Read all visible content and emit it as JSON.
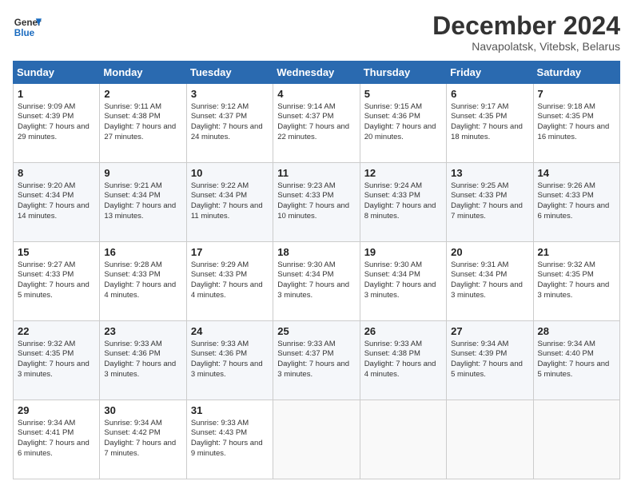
{
  "header": {
    "logo_line1": "General",
    "logo_line2": "Blue",
    "month_title": "December 2024",
    "subtitle": "Navapolatsk, Vitebsk, Belarus"
  },
  "days_of_week": [
    "Sunday",
    "Monday",
    "Tuesday",
    "Wednesday",
    "Thursday",
    "Friday",
    "Saturday"
  ],
  "weeks": [
    [
      {
        "day": "1",
        "sunrise": "Sunrise: 9:09 AM",
        "sunset": "Sunset: 4:39 PM",
        "daylight": "Daylight: 7 hours and 29 minutes."
      },
      {
        "day": "2",
        "sunrise": "Sunrise: 9:11 AM",
        "sunset": "Sunset: 4:38 PM",
        "daylight": "Daylight: 7 hours and 27 minutes."
      },
      {
        "day": "3",
        "sunrise": "Sunrise: 9:12 AM",
        "sunset": "Sunset: 4:37 PM",
        "daylight": "Daylight: 7 hours and 24 minutes."
      },
      {
        "day": "4",
        "sunrise": "Sunrise: 9:14 AM",
        "sunset": "Sunset: 4:37 PM",
        "daylight": "Daylight: 7 hours and 22 minutes."
      },
      {
        "day": "5",
        "sunrise": "Sunrise: 9:15 AM",
        "sunset": "Sunset: 4:36 PM",
        "daylight": "Daylight: 7 hours and 20 minutes."
      },
      {
        "day": "6",
        "sunrise": "Sunrise: 9:17 AM",
        "sunset": "Sunset: 4:35 PM",
        "daylight": "Daylight: 7 hours and 18 minutes."
      },
      {
        "day": "7",
        "sunrise": "Sunrise: 9:18 AM",
        "sunset": "Sunset: 4:35 PM",
        "daylight": "Daylight: 7 hours and 16 minutes."
      }
    ],
    [
      {
        "day": "8",
        "sunrise": "Sunrise: 9:20 AM",
        "sunset": "Sunset: 4:34 PM",
        "daylight": "Daylight: 7 hours and 14 minutes."
      },
      {
        "day": "9",
        "sunrise": "Sunrise: 9:21 AM",
        "sunset": "Sunset: 4:34 PM",
        "daylight": "Daylight: 7 hours and 13 minutes."
      },
      {
        "day": "10",
        "sunrise": "Sunrise: 9:22 AM",
        "sunset": "Sunset: 4:34 PM",
        "daylight": "Daylight: 7 hours and 11 minutes."
      },
      {
        "day": "11",
        "sunrise": "Sunrise: 9:23 AM",
        "sunset": "Sunset: 4:33 PM",
        "daylight": "Daylight: 7 hours and 10 minutes."
      },
      {
        "day": "12",
        "sunrise": "Sunrise: 9:24 AM",
        "sunset": "Sunset: 4:33 PM",
        "daylight": "Daylight: 7 hours and 8 minutes."
      },
      {
        "day": "13",
        "sunrise": "Sunrise: 9:25 AM",
        "sunset": "Sunset: 4:33 PM",
        "daylight": "Daylight: 7 hours and 7 minutes."
      },
      {
        "day": "14",
        "sunrise": "Sunrise: 9:26 AM",
        "sunset": "Sunset: 4:33 PM",
        "daylight": "Daylight: 7 hours and 6 minutes."
      }
    ],
    [
      {
        "day": "15",
        "sunrise": "Sunrise: 9:27 AM",
        "sunset": "Sunset: 4:33 PM",
        "daylight": "Daylight: 7 hours and 5 minutes."
      },
      {
        "day": "16",
        "sunrise": "Sunrise: 9:28 AM",
        "sunset": "Sunset: 4:33 PM",
        "daylight": "Daylight: 7 hours and 4 minutes."
      },
      {
        "day": "17",
        "sunrise": "Sunrise: 9:29 AM",
        "sunset": "Sunset: 4:33 PM",
        "daylight": "Daylight: 7 hours and 4 minutes."
      },
      {
        "day": "18",
        "sunrise": "Sunrise: 9:30 AM",
        "sunset": "Sunset: 4:34 PM",
        "daylight": "Daylight: 7 hours and 3 minutes."
      },
      {
        "day": "19",
        "sunrise": "Sunrise: 9:30 AM",
        "sunset": "Sunset: 4:34 PM",
        "daylight": "Daylight: 7 hours and 3 minutes."
      },
      {
        "day": "20",
        "sunrise": "Sunrise: 9:31 AM",
        "sunset": "Sunset: 4:34 PM",
        "daylight": "Daylight: 7 hours and 3 minutes."
      },
      {
        "day": "21",
        "sunrise": "Sunrise: 9:32 AM",
        "sunset": "Sunset: 4:35 PM",
        "daylight": "Daylight: 7 hours and 3 minutes."
      }
    ],
    [
      {
        "day": "22",
        "sunrise": "Sunrise: 9:32 AM",
        "sunset": "Sunset: 4:35 PM",
        "daylight": "Daylight: 7 hours and 3 minutes."
      },
      {
        "day": "23",
        "sunrise": "Sunrise: 9:33 AM",
        "sunset": "Sunset: 4:36 PM",
        "daylight": "Daylight: 7 hours and 3 minutes."
      },
      {
        "day": "24",
        "sunrise": "Sunrise: 9:33 AM",
        "sunset": "Sunset: 4:36 PM",
        "daylight": "Daylight: 7 hours and 3 minutes."
      },
      {
        "day": "25",
        "sunrise": "Sunrise: 9:33 AM",
        "sunset": "Sunset: 4:37 PM",
        "daylight": "Daylight: 7 hours and 3 minutes."
      },
      {
        "day": "26",
        "sunrise": "Sunrise: 9:33 AM",
        "sunset": "Sunset: 4:38 PM",
        "daylight": "Daylight: 7 hours and 4 minutes."
      },
      {
        "day": "27",
        "sunrise": "Sunrise: 9:34 AM",
        "sunset": "Sunset: 4:39 PM",
        "daylight": "Daylight: 7 hours and 5 minutes."
      },
      {
        "day": "28",
        "sunrise": "Sunrise: 9:34 AM",
        "sunset": "Sunset: 4:40 PM",
        "daylight": "Daylight: 7 hours and 5 minutes."
      }
    ],
    [
      {
        "day": "29",
        "sunrise": "Sunrise: 9:34 AM",
        "sunset": "Sunset: 4:41 PM",
        "daylight": "Daylight: 7 hours and 6 minutes."
      },
      {
        "day": "30",
        "sunrise": "Sunrise: 9:34 AM",
        "sunset": "Sunset: 4:42 PM",
        "daylight": "Daylight: 7 hours and 7 minutes."
      },
      {
        "day": "31",
        "sunrise": "Sunrise: 9:33 AM",
        "sunset": "Sunset: 4:43 PM",
        "daylight": "Daylight: 7 hours and 9 minutes."
      },
      null,
      null,
      null,
      null
    ]
  ]
}
